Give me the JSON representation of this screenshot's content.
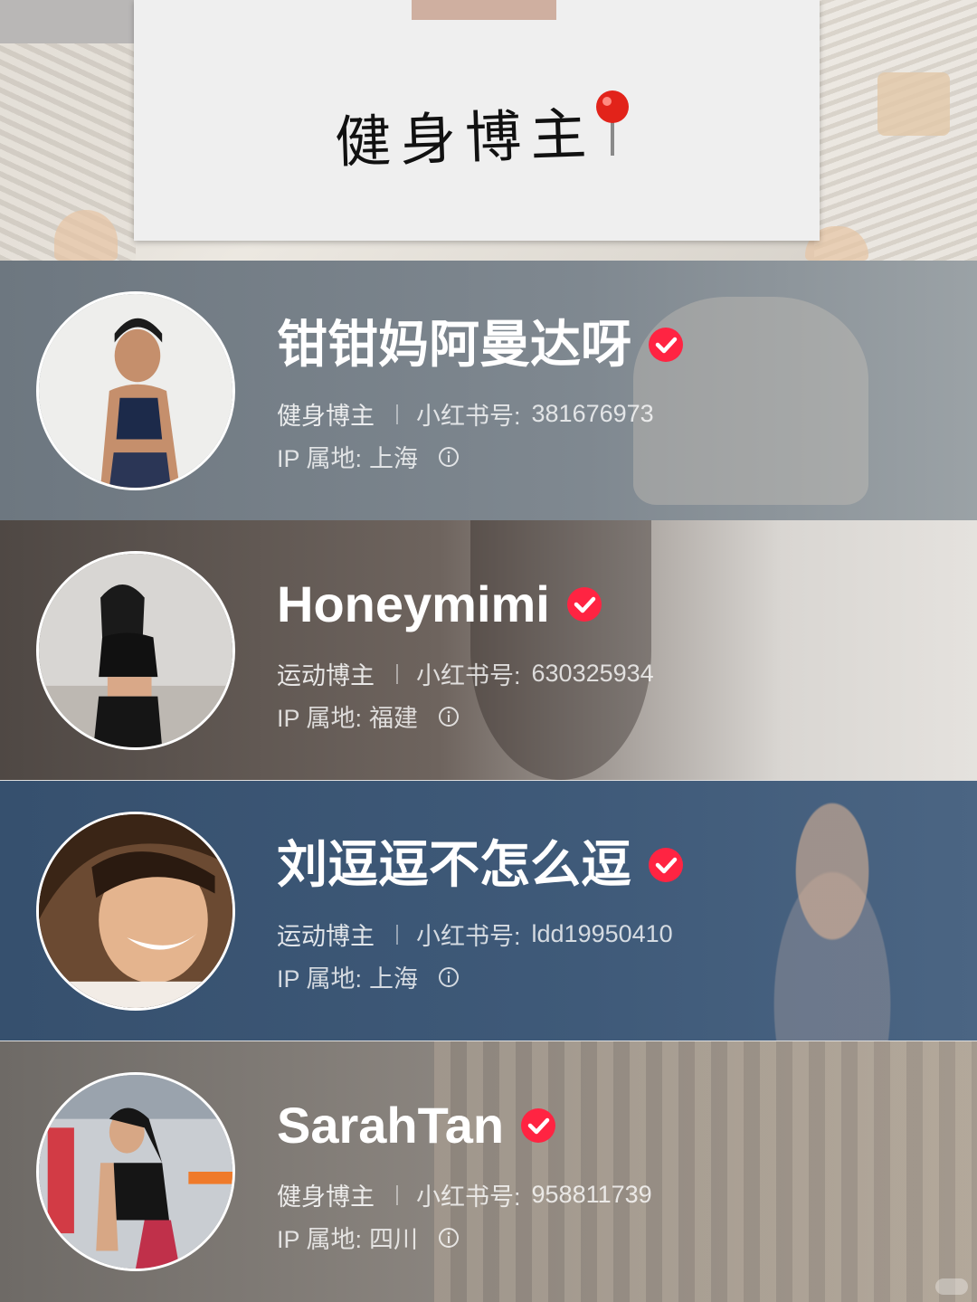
{
  "header": {
    "title": "健身博主",
    "icon": "pushpin-icon"
  },
  "profiles": [
    {
      "name": "钳钳妈阿曼达呀",
      "category": "健身博主",
      "id_label": "小红书号:",
      "id_value": "381676973",
      "ip_label": "IP 属地:",
      "ip_value": "上海",
      "verified": true
    },
    {
      "name": "Honeymimi",
      "category": "运动博主",
      "id_label": "小红书号:",
      "id_value": "630325934",
      "ip_label": "IP 属地:",
      "ip_value": "福建",
      "verified": true
    },
    {
      "name": "刘逗逗不怎么逗",
      "category": "运动博主",
      "id_label": "小红书号:",
      "id_value": "ldd19950410",
      "ip_label": "IP 属地:",
      "ip_value": "上海",
      "verified": true
    },
    {
      "name": "SarahTan",
      "category": "健身博主",
      "id_label": "小红书号:",
      "id_value": "958811739",
      "ip_label": "IP 属地:",
      "ip_value": "四川",
      "verified": true
    }
  ],
  "colors": {
    "verified_badge": "#ff2442",
    "text_primary": "#ffffff"
  }
}
